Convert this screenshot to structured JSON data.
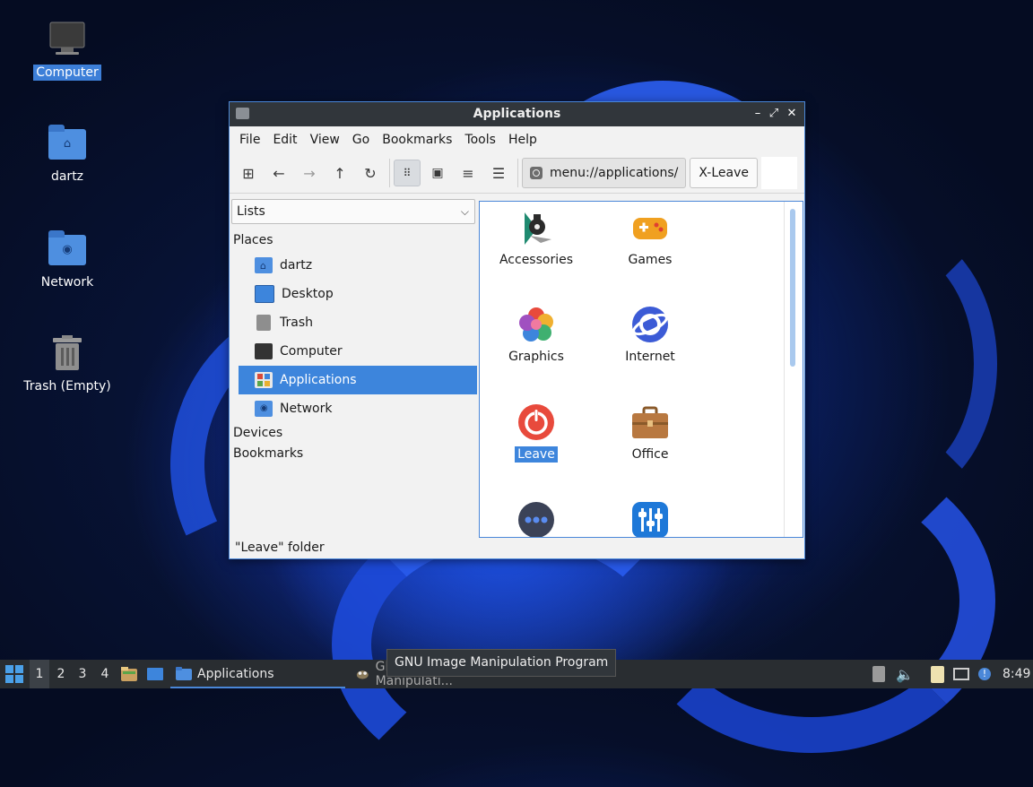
{
  "desktop": {
    "icons": [
      {
        "label": "Computer",
        "icon": "computer-icon",
        "selected": true
      },
      {
        "label": "dartz",
        "icon": "home-folder-icon",
        "selected": false
      },
      {
        "label": "Network",
        "icon": "network-folder-icon",
        "selected": false
      },
      {
        "label": "Trash (Empty)",
        "icon": "trash-icon",
        "selected": false
      }
    ]
  },
  "window": {
    "title": "Applications",
    "controls": {
      "minimize": "–",
      "maximize": "⤢",
      "close": "✕"
    },
    "menu": [
      "File",
      "Edit",
      "View",
      "Go",
      "Bookmarks",
      "Tools",
      "Help"
    ],
    "path": "menu://applications/",
    "crumb": "X-Leave",
    "side_selector": "Lists",
    "sections": {
      "places": "Places",
      "devices": "Devices",
      "bookmarks": "Bookmarks"
    },
    "places": [
      {
        "label": "dartz",
        "icon": "home-folder-icon"
      },
      {
        "label": "Desktop",
        "icon": "desktop-icon"
      },
      {
        "label": "Trash",
        "icon": "trash-icon"
      },
      {
        "label": "Computer",
        "icon": "computer-icon"
      },
      {
        "label": "Applications",
        "icon": "applications-icon",
        "selected": true
      },
      {
        "label": "Network",
        "icon": "network-icon"
      }
    ],
    "items": [
      {
        "label": "Accessories",
        "icon": "accessories-icon"
      },
      {
        "label": "Games",
        "icon": "games-icon"
      },
      {
        "label": "Graphics",
        "icon": "graphics-icon"
      },
      {
        "label": "Internet",
        "icon": "internet-icon"
      },
      {
        "label": "Leave",
        "icon": "leave-icon",
        "selected": true
      },
      {
        "label": "Office",
        "icon": "office-icon"
      },
      {
        "label": "",
        "icon": "other-icon"
      },
      {
        "label": "",
        "icon": "settings-icon"
      }
    ],
    "status": "\"Leave\" folder"
  },
  "tooltip": "GNU Image Manipulation Program",
  "taskbar": {
    "workspaces": [
      "1",
      "2",
      "3",
      "4"
    ],
    "tasks": [
      {
        "label": "Applications",
        "active": true
      },
      {
        "label": "GNU Image Manipulati...",
        "active": false
      }
    ],
    "clock": "8:49"
  },
  "colors": {
    "accent": "#3d85dc",
    "titlebar": "#31363b",
    "taskbar": "#292d31"
  }
}
